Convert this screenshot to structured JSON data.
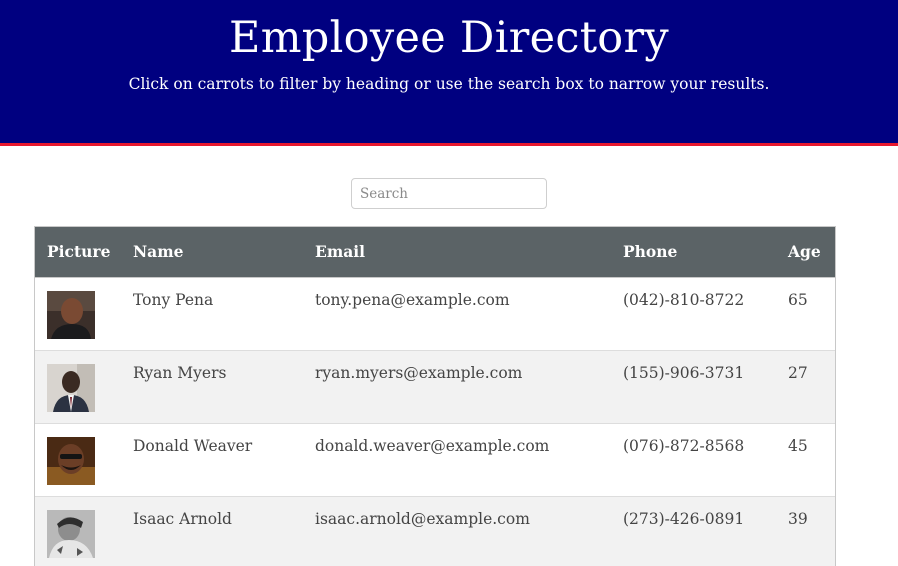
{
  "header": {
    "title": "Employee Directory",
    "subtitle": "Click on carrots to filter by heading or use the search box to narrow your results.",
    "background_color": "#000080",
    "accent_color": "#e8182e"
  },
  "search": {
    "placeholder": "Search",
    "value": ""
  },
  "table": {
    "header_color": "#5b6366",
    "columns": [
      "Picture",
      "Name",
      "Email",
      "Phone",
      "Age"
    ],
    "rows": [
      {
        "name": "Tony Pena",
        "email": "tony.pena@example.com",
        "phone": "(042)-810-8722",
        "age": "65"
      },
      {
        "name": "Ryan Myers",
        "email": "ryan.myers@example.com",
        "phone": "(155)-906-3731",
        "age": "27"
      },
      {
        "name": "Donald Weaver",
        "email": "donald.weaver@example.com",
        "phone": "(076)-872-8568",
        "age": "45"
      },
      {
        "name": "Isaac Arnold",
        "email": "isaac.arnold@example.com",
        "phone": "(273)-426-0891",
        "age": "39"
      }
    ]
  }
}
